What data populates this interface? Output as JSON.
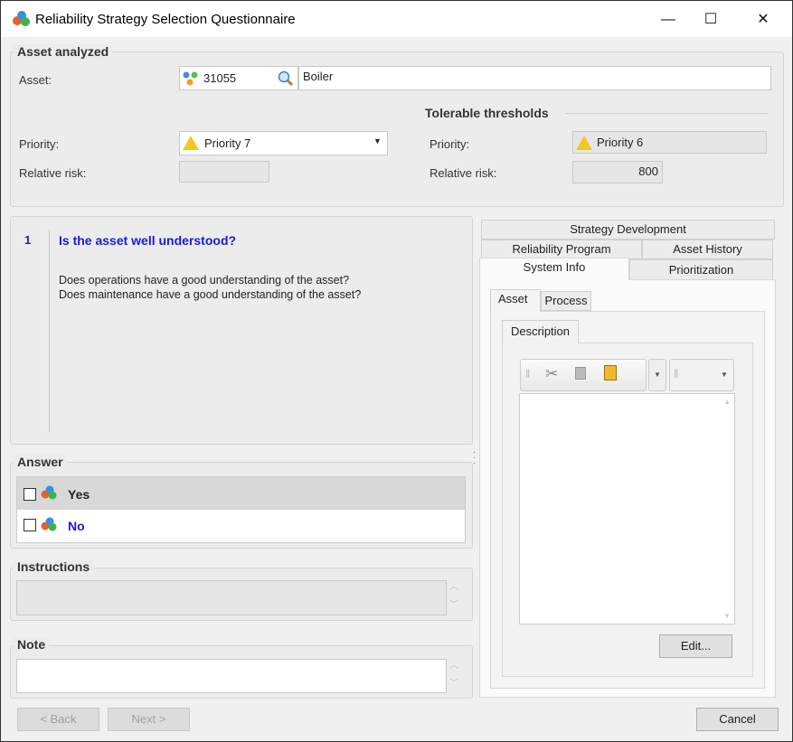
{
  "window": {
    "title": "Reliability Strategy Selection Questionnaire",
    "minimize": "—",
    "maximize": "☐",
    "close": "✕"
  },
  "asset": {
    "group_title": "Asset analyzed",
    "asset_label": "Asset:",
    "asset_id": "31055",
    "asset_name": "Boiler",
    "priority_label": "Priority:",
    "priority_value": "Priority 7",
    "risk_label": "Relative risk:",
    "risk_value": ""
  },
  "thresholds": {
    "title": "Tolerable thresholds",
    "priority_label": "Priority:",
    "priority_value": "Priority 6",
    "risk_label": "Relative risk:",
    "risk_value": "800"
  },
  "question": {
    "number": "1",
    "title": "Is the asset well understood?",
    "lines": [
      "Does operations have a good understanding of the asset?",
      "Does maintenance have a good understanding of the asset?"
    ]
  },
  "answer": {
    "title": "Answer",
    "options": [
      {
        "label": "Yes"
      },
      {
        "label": "No"
      }
    ]
  },
  "instructions": {
    "title": "Instructions"
  },
  "note": {
    "title": "Note"
  },
  "tabs": {
    "row1": [
      "Strategy Development"
    ],
    "row2": [
      "Reliability Program",
      "Asset History"
    ],
    "row3": [
      "System Info",
      "Prioritization"
    ],
    "sub": [
      "Asset",
      "Process"
    ],
    "subsub": [
      "Description"
    ]
  },
  "buttons": {
    "back": "< Back",
    "next": "Next >",
    "cancel": "Cancel",
    "edit": "Edit..."
  }
}
